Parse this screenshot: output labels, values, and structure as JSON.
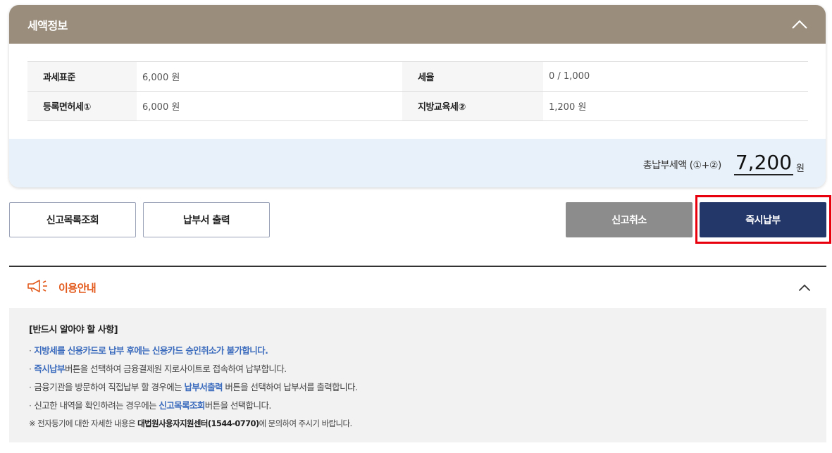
{
  "tax_info": {
    "title": "세액정보",
    "rows": [
      {
        "label1": "과세표준",
        "value1": "6,000 원",
        "label2": "세율",
        "value2": "0 / 1,000"
      },
      {
        "label1": "등록면허세①",
        "value1": "6,000 원",
        "label2": "지방교육세②",
        "value2": "1,200 원"
      }
    ],
    "total_label": "총납부세액 (①+②)",
    "total_amount": "7,200",
    "total_unit": "원"
  },
  "buttons": {
    "report_list": "신고목록조회",
    "print_bill": "납부서 출력",
    "cancel_report": "신고취소",
    "pay_now": "즉시납부"
  },
  "guide": {
    "title": "이용안내",
    "heading": "[반드시 알아야 할 사항]",
    "item1": "지방세를 신용카드로 납부 후에는 신용카드 승인취소가 불가합니다.",
    "item2_highlight": "즉시납부",
    "item2_rest": "버튼을 선택하여 금융결제원 지로사이트로 접속하여 납부합니다.",
    "item3_pre": "금융기관을 방문하여 직접납부 할 경우에는 ",
    "item3_highlight": "납부서출력",
    "item3_post": " 버튼을 선택하여 납부서를 출력합니다.",
    "item4_pre": "신고한 내역을 확인하려는 경우에는 ",
    "item4_highlight": "신고목록조회",
    "item4_post": "버튼을 선택합니다.",
    "note_pre": "※ 전자등기에 대한 자세한 내용은 ",
    "note_bold": "대법원사용자지원센터(1544-0770)",
    "note_post": "에 문의하여 주시기 바랍니다."
  },
  "colors": {
    "header_bg": "#9a8d7b",
    "total_bar_bg": "#e8f1f9",
    "pay_button": "#243769",
    "cancel_button": "#8c8c8c",
    "guide_accent": "#e2591b",
    "highlight_link": "#3b6bbd",
    "annotation_box": "#e8000d"
  },
  "icons": {
    "tax_toggle": "chevron-up-icon",
    "guide_icon": "megaphone-icon",
    "guide_toggle": "chevron-up-icon"
  }
}
